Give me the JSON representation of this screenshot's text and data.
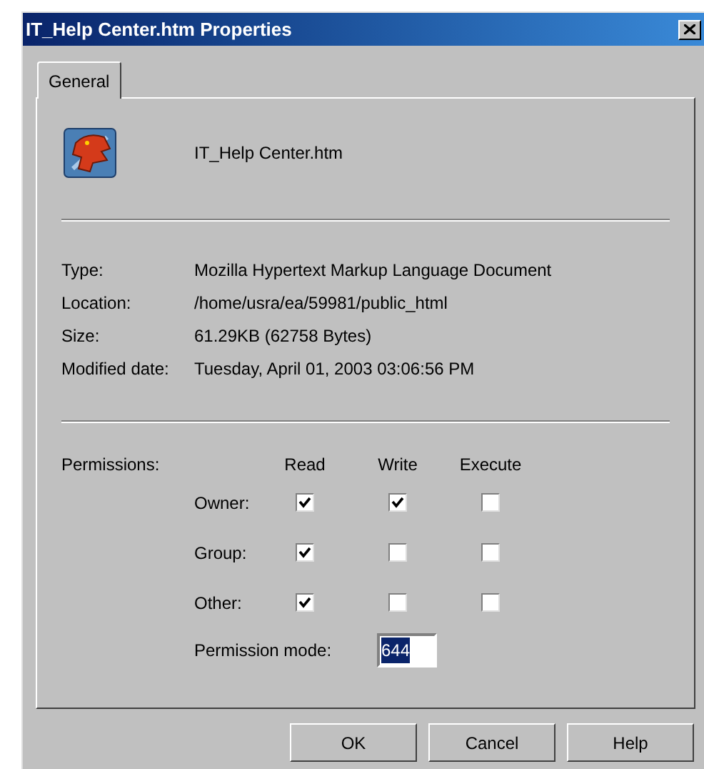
{
  "window": {
    "title": "IT_Help Center.htm Properties"
  },
  "tabs": [
    {
      "label": "General",
      "selected": true
    }
  ],
  "file_name": "IT_Help Center.htm",
  "properties": [
    {
      "label": "Type:",
      "value": "Mozilla Hypertext Markup Language Document"
    },
    {
      "label": "Location:",
      "value": "/home/usra/ea/59981/public_html"
    },
    {
      "label": "Size:",
      "value": "61.29KB (62758 Bytes)"
    },
    {
      "label": "Modified date:",
      "value": "Tuesday, April 01, 2003 03:06:56 PM"
    }
  ],
  "permissions": {
    "label": "Permissions:",
    "columns": [
      "Read",
      "Write",
      "Execute"
    ],
    "rows": [
      {
        "label": "Owner:",
        "checked": [
          true,
          true,
          false
        ]
      },
      {
        "label": "Group:",
        "checked": [
          true,
          false,
          false
        ]
      },
      {
        "label": "Other:",
        "checked": [
          true,
          false,
          false
        ]
      }
    ],
    "mode_label": "Permission mode:",
    "mode_value": "644"
  },
  "buttons": [
    "OK",
    "Cancel",
    "Help"
  ]
}
